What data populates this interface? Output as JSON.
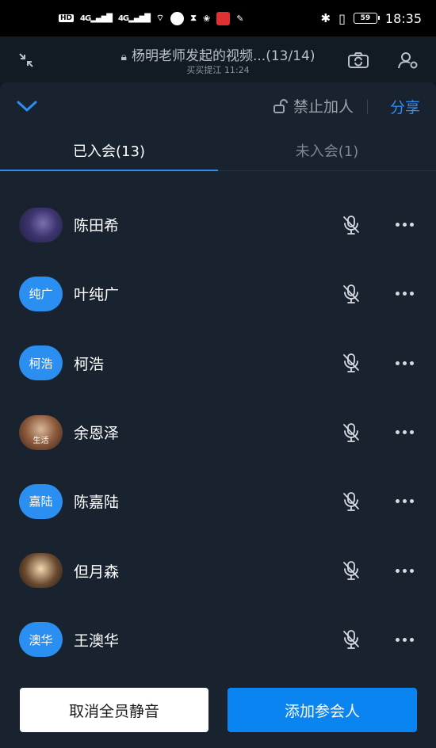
{
  "status_bar": {
    "left_badges": [
      "HD",
      "4G",
      "4G"
    ],
    "time": "18:35",
    "battery": "59"
  },
  "meeting": {
    "title": "杨明老师发起的视频...(13/14)",
    "subtitle": "买买提江 11:24"
  },
  "panel": {
    "lock_label": "禁止加人",
    "share_label": "分享",
    "tabs": [
      {
        "label": "已入会(13)",
        "active": true
      },
      {
        "label": "未入会(1)",
        "active": false
      }
    ]
  },
  "members": [
    {
      "name": "陈田希",
      "avatar_text": "",
      "avatar_type": "photo1",
      "muted": true
    },
    {
      "name": "叶纯广",
      "avatar_text": "纯广",
      "avatar_type": "initials",
      "muted": true
    },
    {
      "name": "柯浩",
      "avatar_text": "柯浩",
      "avatar_type": "initials",
      "muted": true
    },
    {
      "name": "余恩泽",
      "avatar_text": "生活",
      "avatar_type": "photo2",
      "muted": true
    },
    {
      "name": "陈嘉陆",
      "avatar_text": "嘉陆",
      "avatar_type": "initials",
      "muted": true
    },
    {
      "name": "但月森",
      "avatar_text": "",
      "avatar_type": "photo3",
      "muted": true
    },
    {
      "name": "王澳华",
      "avatar_text": "澳华",
      "avatar_type": "initials",
      "muted": true
    }
  ],
  "actions": {
    "mute_all_cancel": "取消全员静音",
    "add_participant": "添加参会人"
  },
  "colors": {
    "accent": "#2d8df0",
    "avatar_blue": "#2b8ff2",
    "panel_bg": "#19232f",
    "page_bg": "#0f1823"
  }
}
